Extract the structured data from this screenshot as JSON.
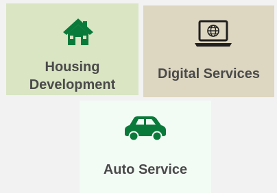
{
  "tiles": {
    "housing": {
      "label": "Housing Development",
      "label_lines": [
        "Housing",
        "Development"
      ],
      "icon": "house-icon",
      "bg_color": "#d9e5c3"
    },
    "digital": {
      "label": "Digital Services",
      "icon": "laptop-globe-icon",
      "bg_color": "#ddd6c0"
    },
    "auto": {
      "label": "Auto Service",
      "icon": "car-icon",
      "bg_color": "#f3fbf5"
    }
  },
  "colors": {
    "page_background": "#f2f2f2",
    "icon_green": "#0a7a3b",
    "icon_dark": "#1f1f1f",
    "label_gray": "#4a4a4a"
  }
}
